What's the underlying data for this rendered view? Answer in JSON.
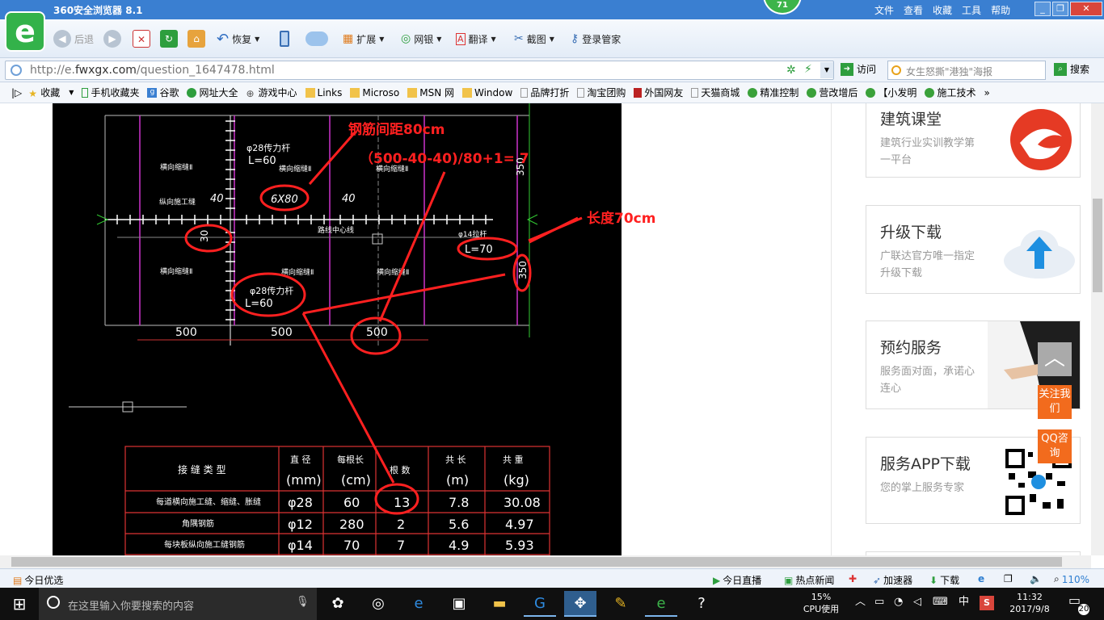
{
  "window": {
    "title": "360安全浏览器 8.1",
    "badge": "71",
    "menus": [
      "文件",
      "查看",
      "收藏",
      "工具",
      "帮助"
    ]
  },
  "toolbar": {
    "back": "后退",
    "restore": "恢复",
    "extend": "扩展",
    "bank": "网银",
    "translate": "翻译",
    "screenshot": "截图",
    "login": "登录管家"
  },
  "address": {
    "url_prefix": "http://e.",
    "url_domain": "fwxgx.com",
    "url_path": "/question_1647478.html",
    "visit": "访问",
    "search_placeholder": "女生怒撕\"港独\"海报",
    "search_btn": "搜索"
  },
  "favorites": [
    "收藏",
    "手机收藏夹",
    "谷歌",
    "网址大全",
    "游戏中心",
    "Links",
    "Microso",
    "MSN 网",
    "Window",
    "品牌打折",
    "淘宝团购",
    "外国网友",
    "天猫商城",
    "精准控制",
    "营改增后",
    "【小发明",
    "施工技术"
  ],
  "cad": {
    "ann_spacing": "钢筋间距80cm",
    "ann_formula": "（500-40-40)/80+1= 7",
    "ann_length": "长度70cm",
    "label_phi28_top": "φ28传力杆",
    "label_l60_top": "L=60",
    "label_phi28_bot": "φ28传力杆",
    "label_l60_bot": "L=60",
    "label_phi14": "φ14拉杆",
    "label_l70": "L=70",
    "label_6x80": "6X80",
    "label_40a": "40",
    "label_40b": "40",
    "label_30": "30",
    "label_350a": "350",
    "label_350b": "350",
    "label_joint1": "横向缩缝Ⅱ",
    "label_joint2": "横向缩缝Ⅱ",
    "label_joint3": "横向缩缝Ⅱ",
    "label_joint4": "横向缩缝Ⅱ",
    "label_joint5": "横向缩缝Ⅱ",
    "label_joint6": "横向缩缝Ⅱ",
    "label_long": "纵向施工缝",
    "label_center": "路线中心线",
    "dims": [
      "500",
      "500",
      "500"
    ],
    "table": {
      "headers": [
        "接 缝 类 型",
        "直 径\n(mm)",
        "每根长\n(cm)",
        "根 数",
        "共 长\n(m)",
        "共 重\n(kg)"
      ],
      "rows": [
        [
          "每道横向施工缝、缩缝、胀缝",
          "φ28",
          "60",
          "13",
          "7.8",
          "30.08"
        ],
        [
          "角隅钢筋",
          "φ12",
          "280",
          "2",
          "5.6",
          "4.97"
        ],
        [
          "每块板纵向施工缝钢筋",
          "φ14",
          "70",
          "7",
          "4.9",
          "5.93"
        ]
      ]
    }
  },
  "sidebar": {
    "cards": [
      {
        "title": "建筑课堂",
        "sub": "建筑行业实训教学第一平台"
      },
      {
        "title": "升级下载",
        "sub": "广联达官方唯一指定升级下载"
      },
      {
        "title": "预约服务",
        "sub": "服务面对面，承诺心连心"
      },
      {
        "title": "服务APP下载",
        "sub": "您的掌上服务专家"
      }
    ],
    "float_top": "︿",
    "follow": "关注我们",
    "qq": "QQ咨询"
  },
  "status": {
    "today": "今日优选",
    "live": "今日直播",
    "news": "热点新闻",
    "accel": "加速器",
    "download": "下载",
    "zoom": "110%"
  },
  "taskbar": {
    "search": "在这里输入你要搜索的内容",
    "cpu_pct": "15%",
    "cpu_label": "CPU使用",
    "ime": "中",
    "time": "11:32",
    "date": "2017/9/8",
    "notif": "20"
  },
  "colors": {
    "titlebar": "#3a7fd1",
    "annotation": "#ff2020",
    "accent_orange": "#f26b1d",
    "logo_green": "#33b24a"
  }
}
